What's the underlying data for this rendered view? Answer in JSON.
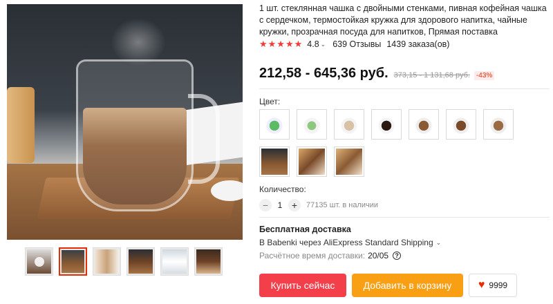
{
  "product": {
    "title": "1 шт. стеклянная чашка с двойными стенками, пивная кофейная чашка с сердечком, термостойкая кружка для здорового напитка, чайные кружки, прозрачная посуда для напитков, Прямая поставка",
    "stars": "★★★★★",
    "rating": "4.8",
    "reviews": "639 Отзывы",
    "orders": "1439 заказа(ов)"
  },
  "price": {
    "current": "212,58 - 645,36 руб.",
    "old": "373,15 - 1 131,68 руб.",
    "discount": "-43%"
  },
  "color": {
    "label": "Цвет:",
    "options": [
      "swatch-1",
      "swatch-2",
      "swatch-3",
      "swatch-4",
      "swatch-5",
      "swatch-6",
      "swatch-7",
      "swatch-8",
      "swatch-9",
      "swatch-10"
    ]
  },
  "quantity": {
    "label": "Количество:",
    "minus": "−",
    "plus": "+",
    "value": "1",
    "stock": "77135 шт. в наличии"
  },
  "shipping": {
    "title": "Бесплатная доставка",
    "line": "В Babenki через AliExpress Standard Shipping",
    "date_label": "Расчётное время доставки:",
    "date_value": "20/05",
    "help": "?"
  },
  "buttons": {
    "buy": "Купить сейчас",
    "cart": "Добавить в корзину",
    "wish_count": "9999"
  },
  "icons": {
    "chevron": "⌄",
    "heart": "♥"
  },
  "colors": {
    "buy": "#f33f4a",
    "cart": "#f89f14",
    "accent": "#e62e04"
  }
}
